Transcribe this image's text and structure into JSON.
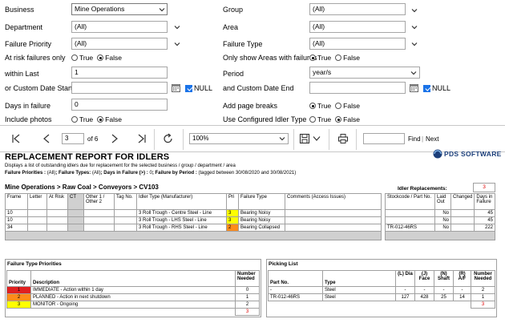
{
  "filters": {
    "business": {
      "label": "Business",
      "value": "Mine Operations"
    },
    "department": {
      "label": "Department",
      "value": "(All)"
    },
    "failure_priority": {
      "label": "Failure Priority",
      "value": "(All)"
    },
    "at_risk": {
      "label": "At risk failures only",
      "options": [
        "True",
        "False"
      ],
      "selected": "False"
    },
    "within_last": {
      "label": "within Last",
      "value": "1"
    },
    "custom_start": {
      "label": "or Custom Date Start",
      "value": "",
      "null_label": "NULL"
    },
    "days_in_failure": {
      "label": "Days in failure",
      "value": "0"
    },
    "include_photos": {
      "label": "Include photos",
      "options": [
        "True",
        "False"
      ],
      "selected": "False"
    },
    "group": {
      "label": "Group",
      "value": "(All)"
    },
    "area": {
      "label": "Area",
      "value": "(All)"
    },
    "failure_type": {
      "label": "Failure Type",
      "value": "(All)"
    },
    "only_show_areas": {
      "label": "Only show Areas with failures",
      "options": [
        "True",
        "False"
      ],
      "selected": "True"
    },
    "period": {
      "label": "Period",
      "value": "year/s"
    },
    "custom_end": {
      "label": "and Custom Date End",
      "value": "",
      "null_label": "NULL"
    },
    "add_page_breaks": {
      "label": "Add page breaks",
      "options": [
        "True",
        "False"
      ],
      "selected": "True"
    },
    "use_configured_idler": {
      "label": "Use Configured Idler Type",
      "options": [
        "True",
        "False"
      ],
      "selected": "False"
    }
  },
  "toolbar": {
    "page_current": "3",
    "page_of": "of 6",
    "zoom": "100%",
    "find_label": "Find",
    "separator": "|",
    "next_label": "Next"
  },
  "report": {
    "title": "REPLACEMENT REPORT FOR IDLERS",
    "logo_text": "PDS SOFTWARE",
    "description": "Displays a list of outstanding idlers due for replacement for the selected business / group / department  / area",
    "criteria_prefix": "Failure Priorities : ",
    "criteria_prefix_value": "(All)",
    "criteria_ft": "; Failure Types: ",
    "criteria_ft_value": "(All)",
    "criteria_dif": "; Days in Failure (>) : ",
    "criteria_dif_value": "0",
    "criteria_period": "; Failure by Period : ",
    "criteria_period_value": "(tagged between 30/08/2020 and 30/08/2021)",
    "breadcrumb": "Mine Operations > Raw Coal > Conveyors > CV103",
    "idler_replacements_label": "Idler Replacements:",
    "idler_replacements_value": "3"
  },
  "main_table": {
    "headers": [
      "Frame",
      "Letter",
      "At Risk",
      "CT",
      "Other 1 / Other 2",
      "Tag No.",
      "Idler Type (Manufacturer)",
      "Pri",
      "Failure Type",
      "Comments (Access Issues)",
      "Stockcode / Part No.",
      "Laid Out",
      "Changed",
      "Days in Failure"
    ],
    "rows": [
      {
        "frame": "10",
        "idler_type": "3 Roll Trough - Centre Steel - Line",
        "pri": "3",
        "failure": "Bearing Noisy",
        "stockcode": "",
        "laid_out": "No",
        "days": "45"
      },
      {
        "frame": "10",
        "idler_type": "3 Roll Trough - LHS Steel - Line",
        "pri": "3",
        "failure": "Bearing Noisy",
        "stockcode": "",
        "laid_out": "No",
        "days": "45"
      },
      {
        "frame": "34",
        "idler_type": "3 Roll Trough - RHS Steel - Line",
        "pri": "2",
        "failure": "Bearing Collapsed",
        "stockcode": "TR-012-46RS",
        "laid_out": "No",
        "days": "222"
      }
    ]
  },
  "priorities": {
    "title": "Failure Type Priorities",
    "headers": [
      "Priority",
      "Description",
      "Number Needed"
    ],
    "rows": [
      {
        "priority": "1",
        "description": "IMMEDIATE - Action within 1 day",
        "needed": "0",
        "color": "#e02020"
      },
      {
        "priority": "2",
        "description": "PLANNED - Action in next shutdown",
        "needed": "1",
        "color": "#ff8c1a"
      },
      {
        "priority": "3",
        "description": "MONITOR - Ongoing",
        "needed": "2",
        "color": "#ffff00"
      }
    ],
    "total": "3"
  },
  "picking": {
    "title": "Picking List",
    "headers": [
      "Part No.",
      "Type",
      "(L) Dia",
      "(J) Face",
      "(N) Shaft",
      "(R) A/F",
      "Number Needed"
    ],
    "rows": [
      {
        "part": "-",
        "type": "Steel",
        "dia": "-",
        "face": "-",
        "shaft": "-",
        "af": "-",
        "needed": "2"
      },
      {
        "part": "TR-012-46RS",
        "type": "Steel",
        "dia": "127",
        "face": "428",
        "shaft": "25",
        "af": "14",
        "needed": "1"
      }
    ],
    "total": "3"
  }
}
